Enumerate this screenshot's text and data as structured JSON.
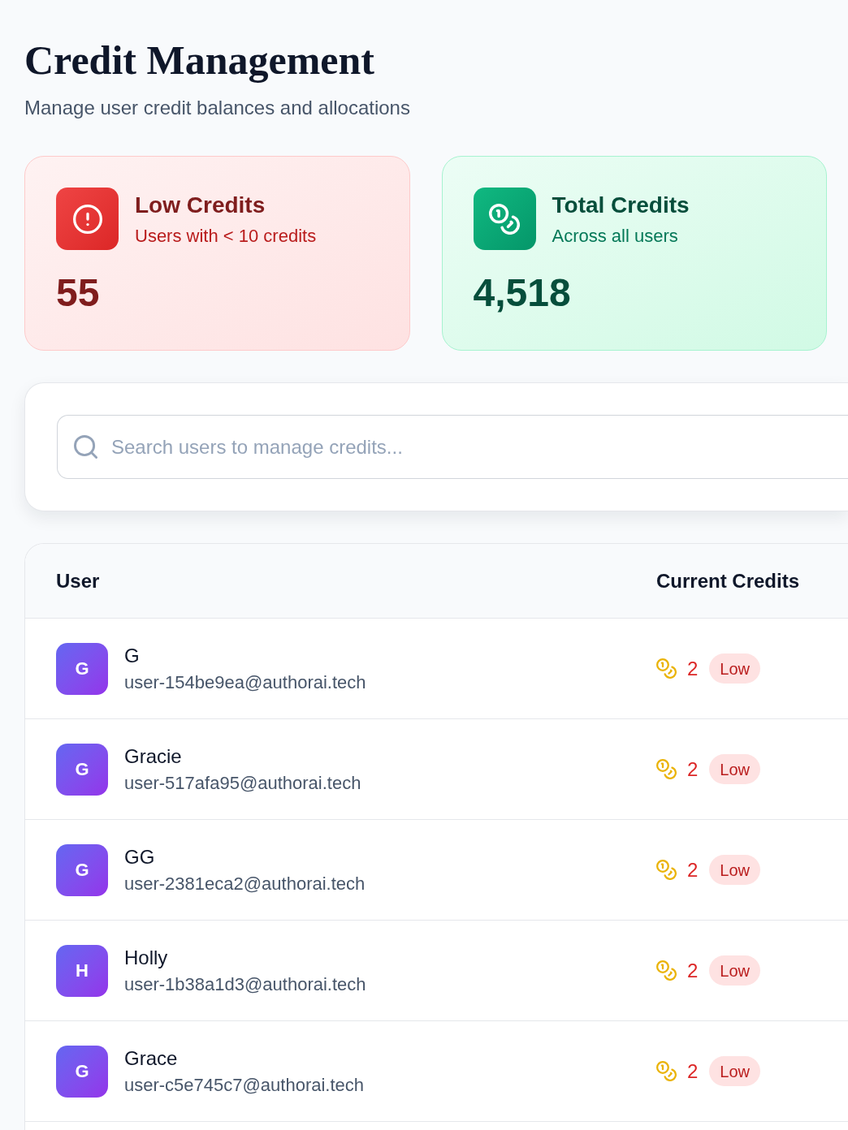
{
  "header": {
    "title": "Credit Management",
    "subtitle": "Manage user credit balances and allocations"
  },
  "stats": [
    {
      "kind": "low",
      "title": "Low Credits",
      "subtitle": "Users with < 10 credits",
      "value": "55"
    },
    {
      "kind": "total",
      "title": "Total Credits",
      "subtitle": "Across all users",
      "value": "4,518"
    }
  ],
  "search": {
    "placeholder": "Search users to manage credits..."
  },
  "table": {
    "columns": [
      "User",
      "Current Credits"
    ],
    "rows": [
      {
        "initial": "G",
        "name": "G",
        "email": "user-154be9ea@authorai.tech",
        "credits": "2",
        "badge": "Low"
      },
      {
        "initial": "G",
        "name": "Gracie",
        "email": "user-517afa95@authorai.tech",
        "credits": "2",
        "badge": "Low"
      },
      {
        "initial": "G",
        "name": "GG",
        "email": "user-2381eca2@authorai.tech",
        "credits": "2",
        "badge": "Low"
      },
      {
        "initial": "H",
        "name": "Holly",
        "email": "user-1b38a1d3@authorai.tech",
        "credits": "2",
        "badge": "Low"
      },
      {
        "initial": "G",
        "name": "Grace",
        "email": "user-c5e745c7@authorai.tech",
        "credits": "2",
        "badge": "Low"
      }
    ]
  }
}
